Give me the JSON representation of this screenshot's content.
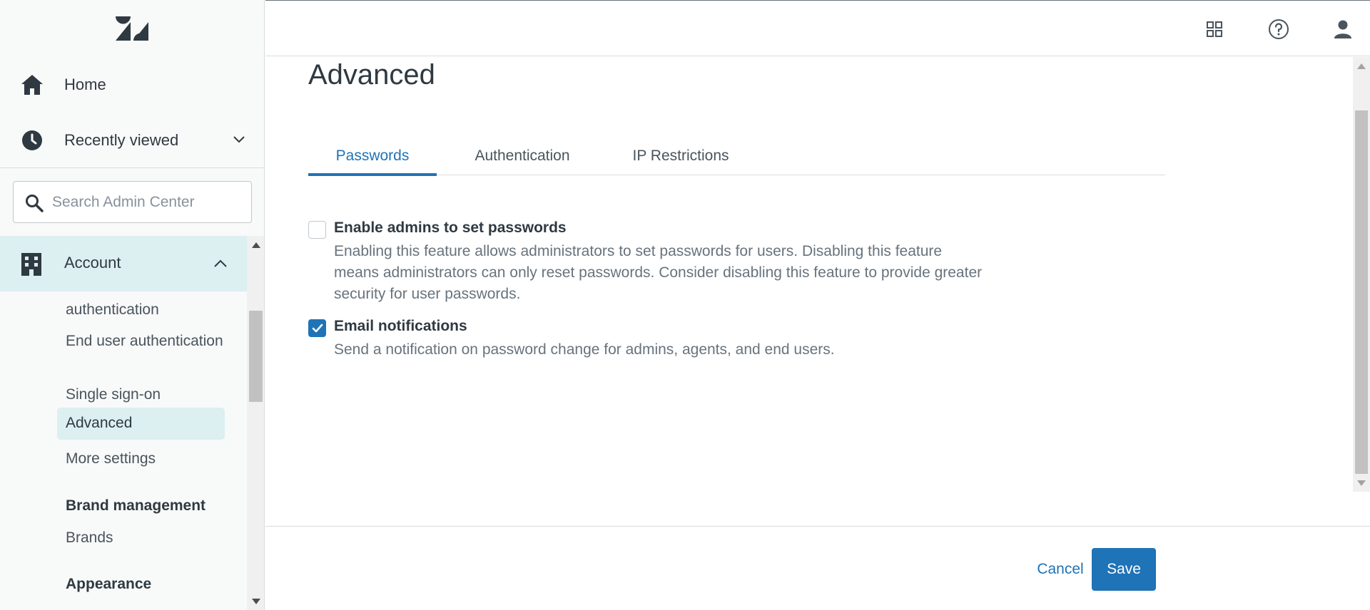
{
  "sidebar": {
    "logo_icon": "zendesk-logo",
    "home": {
      "label": "Home",
      "icon": "home-icon"
    },
    "recently_viewed": {
      "label": "Recently viewed",
      "icon": "clock-icon"
    },
    "search": {
      "placeholder": "Search Admin Center",
      "value": ""
    },
    "account": {
      "label": "Account",
      "icon": "building-icon",
      "expanded": true
    },
    "account_items": [
      {
        "label": "authentication"
      },
      {
        "label": "End user authentication"
      },
      {
        "label": "Single sign-on"
      },
      {
        "label": "Advanced",
        "active": true
      },
      {
        "label": "More settings"
      }
    ],
    "sections": [
      {
        "title": "Brand management",
        "items": [
          {
            "label": "Brands"
          }
        ]
      },
      {
        "title": "Appearance"
      }
    ]
  },
  "header": {
    "icons": [
      "apps-grid-icon",
      "help-icon",
      "profile-icon"
    ]
  },
  "main": {
    "title": "Advanced",
    "tabs": [
      {
        "label": "Passwords",
        "active": true
      },
      {
        "label": "Authentication",
        "active": false
      },
      {
        "label": "IP Restrictions",
        "active": false
      }
    ],
    "options": [
      {
        "label": "Enable admins to set passwords",
        "description": "Enabling this feature allows administrators to set passwords for users. Disabling this feature means administrators can only reset passwords. Consider disabling this feature to provide greater security for user passwords.",
        "checked": false
      },
      {
        "label": "Email notifications",
        "description": "Send a notification on password change for admins, agents, and end users.",
        "checked": true
      }
    ]
  },
  "footer": {
    "cancel_label": "Cancel",
    "save_label": "Save"
  },
  "colors": {
    "accent": "#1f73b7",
    "active_nav_bg": "#dceff1",
    "sidebar_bg": "#f8f9f9"
  }
}
